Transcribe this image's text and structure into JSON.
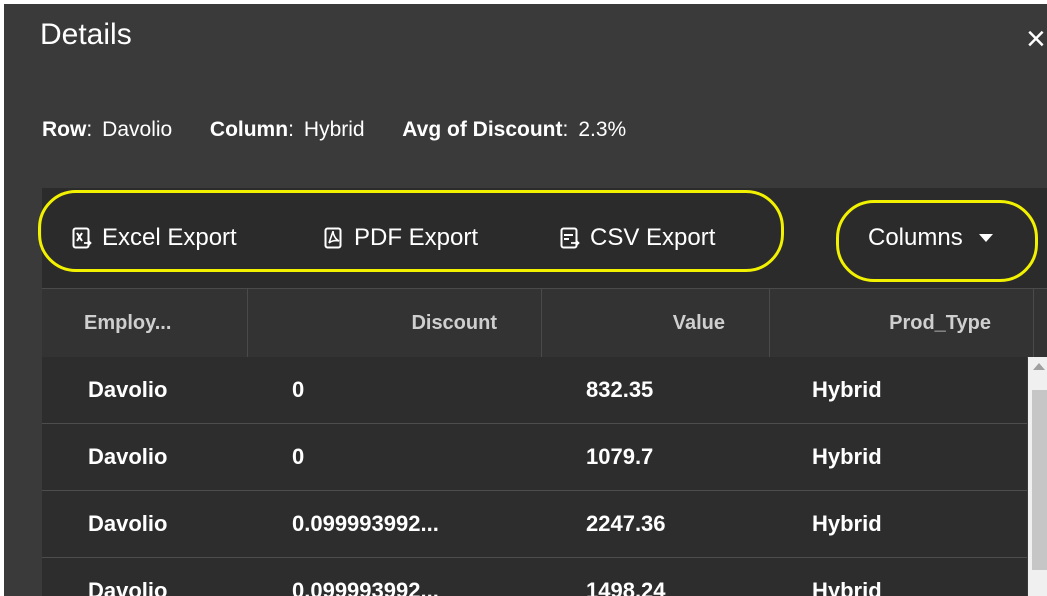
{
  "dialog": {
    "title": "Details",
    "close_icon": "close-icon",
    "close_glyph": "×"
  },
  "info": {
    "row_key": "Row",
    "row_value": "Davolio",
    "column_key": "Column",
    "column_value": "Hybrid",
    "agg_key": "Avg of Discount",
    "agg_value": "2.3%"
  },
  "toolbar": {
    "excel_label": "Excel Export",
    "pdf_label": "PDF Export",
    "csv_label": "CSV Export",
    "columns_label": "Columns",
    "highlight_color": "#f2f200"
  },
  "grid": {
    "headers": [
      "Employ...",
      "Discount",
      "Value",
      "Prod_Type"
    ],
    "rows": [
      [
        "Davolio",
        "0",
        "832.35",
        "Hybrid"
      ],
      [
        "Davolio",
        "0",
        "1079.7",
        "Hybrid"
      ],
      [
        "Davolio",
        "0.099993992...",
        "2247.36",
        "Hybrid"
      ],
      [
        "Davolio",
        "0.099993992...",
        "1498.24",
        "Hybrid"
      ]
    ]
  }
}
